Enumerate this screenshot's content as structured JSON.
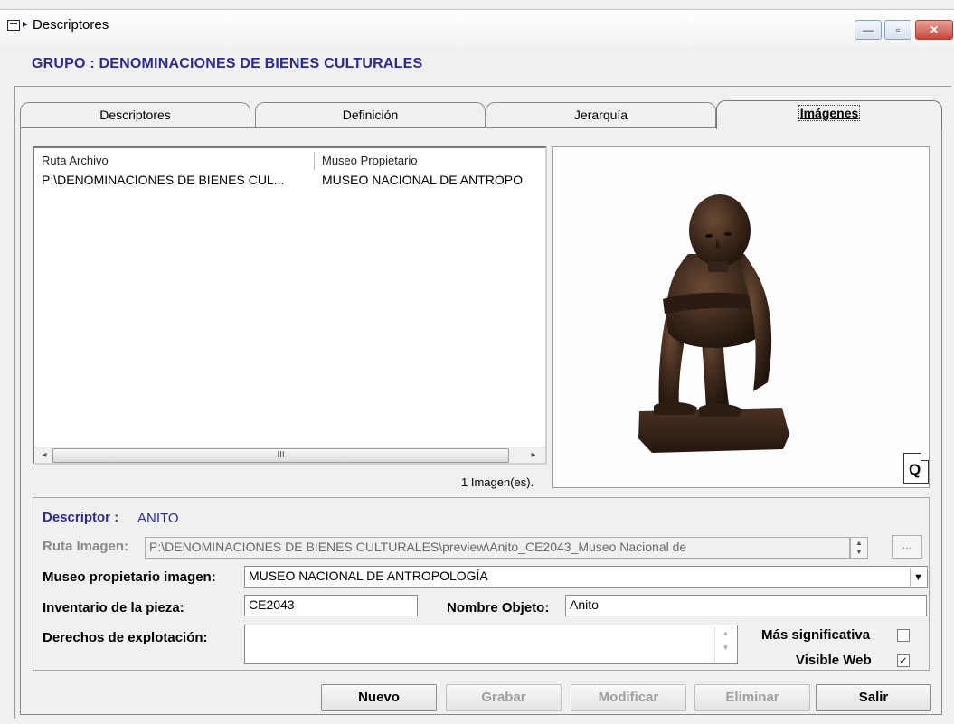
{
  "window": {
    "title": "Descriptores",
    "min_glyph": "—",
    "max_glyph": "▫",
    "close_glyph": "✕"
  },
  "group": {
    "title": "GRUPO :  DENOMINACIONES DE BIENES CULTURALES"
  },
  "tabs": [
    {
      "label": "Descriptores"
    },
    {
      "label": "Definición"
    },
    {
      "label": "Jerarquía"
    },
    {
      "label": "Imágenes",
      "active": true
    }
  ],
  "images_list": {
    "columns": [
      "Ruta Archivo",
      "Museo Propietario"
    ],
    "rows": [
      [
        "P:\\DENOMINACIONES DE BIENES CUL...",
        "MUSEO NACIONAL DE ANTROPO"
      ]
    ],
    "scroll_thumb": "III",
    "count_text": "1 Imagen(es)."
  },
  "preview": {
    "zoom_glyph": "Q"
  },
  "details": {
    "descriptor_label": "Descriptor :",
    "descriptor_value": "ANITO",
    "ruta_label": "Ruta Imagen:",
    "ruta_value": "P:\\DENOMINACIONES DE BIENES CULTURALES\\preview\\Anito_CE2043_Museo Nacional de",
    "browse_label": "...",
    "museo_label": "Museo propietario imagen:",
    "museo_value": "MUSEO NACIONAL DE ANTROPOLOGÍA",
    "inventario_label": "Inventario de la pieza:",
    "inventario_value": "CE2043",
    "nombre_label": "Nombre Objeto:",
    "nombre_value": "Anito",
    "derechos_label": "Derechos de explotación:",
    "derechos_value": "",
    "significativa_label": "Más significativa",
    "significativa_checked": false,
    "visible_label": "Visible Web",
    "visible_checked": true,
    "check_glyph": "✓"
  },
  "buttons": {
    "nuevo": "Nuevo",
    "grabar": "Grabar",
    "modificar": "Modificar",
    "eliminar": "Eliminar",
    "salir": "Salir"
  }
}
